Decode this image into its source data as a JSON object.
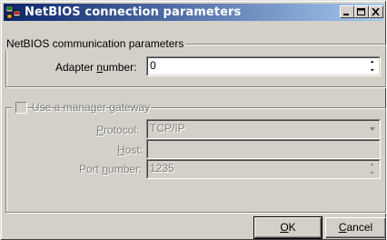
{
  "window": {
    "title": "NetBIOS connection parameters",
    "icon": "netbios-app-icon",
    "controls": [
      "minimize-icon",
      "maximize-icon",
      "close-icon"
    ]
  },
  "communication_group": {
    "legend": "NetBIOS communication parameters",
    "adapter_label_pre": "Adapter ",
    "adapter_label_u": "n",
    "adapter_label_post": "umber:",
    "adapter_value": "0"
  },
  "manager_group": {
    "checkbox_label": "Use a manager gateway",
    "checkbox_checked": false,
    "protocol_label_u": "P",
    "protocol_label_post": "rotocol:",
    "protocol_value": "TCP/IP",
    "host_label_u": "H",
    "host_label_post": "ost:",
    "host_value": "",
    "port_label_pre": "Port ",
    "port_label_u": "n",
    "port_label_post": "umber:",
    "port_value": "1235"
  },
  "buttons": {
    "ok_u": "O",
    "ok_post": "K",
    "cancel_u": "C",
    "cancel_post": "ancel"
  }
}
